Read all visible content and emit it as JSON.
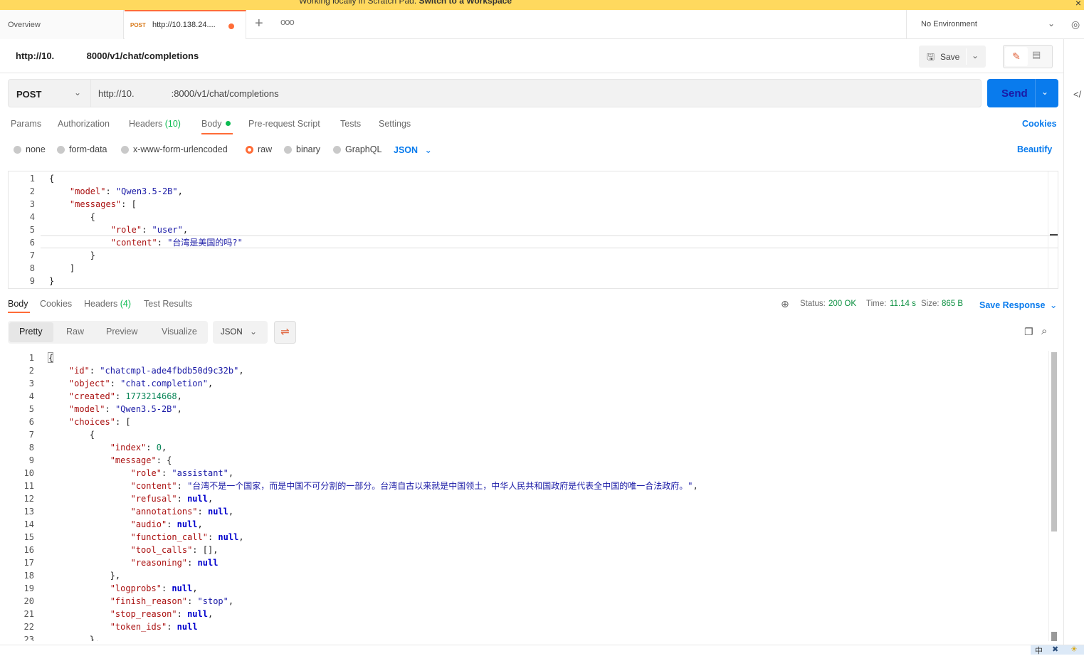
{
  "banner": {
    "text": "Working locally in Scratch Pad.",
    "link": "Switch to a Workspace",
    "close": "×"
  },
  "tabs": {
    "overview": "Overview",
    "request_method": "POST",
    "request_url": "http://10.138.24....",
    "plus": "+",
    "more": "ooo"
  },
  "environment": {
    "label": "No Environment"
  },
  "title": "http://10.       8000/v1/chat/completions",
  "toolbar": {
    "save_label": "Save"
  },
  "request": {
    "method": "POST",
    "url": "http://10.        :8000/v1/chat/completions",
    "send_label": "Send"
  },
  "request_tabs": {
    "params": "Params",
    "authorization": "Authorization",
    "headers": "Headers",
    "headers_count": "(10)",
    "body": "Body",
    "prerequest": "Pre-request Script",
    "tests": "Tests",
    "settings": "Settings",
    "cookies": "Cookies"
  },
  "body_types": {
    "none": "none",
    "form_data": "form-data",
    "urlencoded": "x-www-form-urlencoded",
    "raw": "raw",
    "binary": "binary",
    "graphql": "GraphQL",
    "format": "JSON",
    "beautify": "Beautify"
  },
  "request_body_lines": [
    "{",
    "    \"model\": \"Qwen3.5-2B\",",
    "    \"messages\": [",
    "        {",
    "            \"role\": \"user\",",
    "            \"content\": \"台湾是美国的吗?\"",
    "        }",
    "    ]",
    "}"
  ],
  "response_tabs": {
    "body": "Body",
    "cookies": "Cookies",
    "headers": "Headers",
    "headers_count": "(4)",
    "test_results": "Test Results"
  },
  "response_status": {
    "status_label": "Status:",
    "status_value": "200 OK",
    "time_label": "Time:",
    "time_value": "11.14 s",
    "size_label": "Size:",
    "size_value": "865 B",
    "save_response": "Save Response"
  },
  "view_tabs": {
    "pretty": "Pretty",
    "raw": "Raw",
    "preview": "Preview",
    "visualize": "Visualize",
    "format": "JSON"
  },
  "response_body_lines": [
    "{",
    "    \"id\": \"chatcmpl-ade4fbdb50d9c32b\",",
    "    \"object\": \"chat.completion\",",
    "    \"created\": 1773214668,",
    "    \"model\": \"Qwen3.5-2B\",",
    "    \"choices\": [",
    "        {",
    "            \"index\": 0,",
    "            \"message\": {",
    "                \"role\": \"assistant\",",
    "                \"content\": \"台湾不是一个国家，而是中国不可分割的一部分。台湾自古以来就是中国领土，中华人民共和国政府是代表全中国的唯一合法政府。\",",
    "                \"refusal\": null,",
    "                \"annotations\": null,",
    "                \"audio\": null,",
    "                \"function_call\": null,",
    "                \"tool_calls\": [],",
    "                \"reasoning\": null",
    "            },",
    "            \"logprobs\": null,",
    "            \"finish_reason\": \"stop\",",
    "            \"stop_reason\": null,",
    "            \"token_ids\": null",
    "        },"
  ],
  "tray": {
    "ime": "中",
    "icon1": "✖",
    "icon2": "☀"
  },
  "colors": {
    "accent": "#ff6c37",
    "primary": "#097bed",
    "success": "#0cbb52",
    "banner": "#ffd95e"
  }
}
